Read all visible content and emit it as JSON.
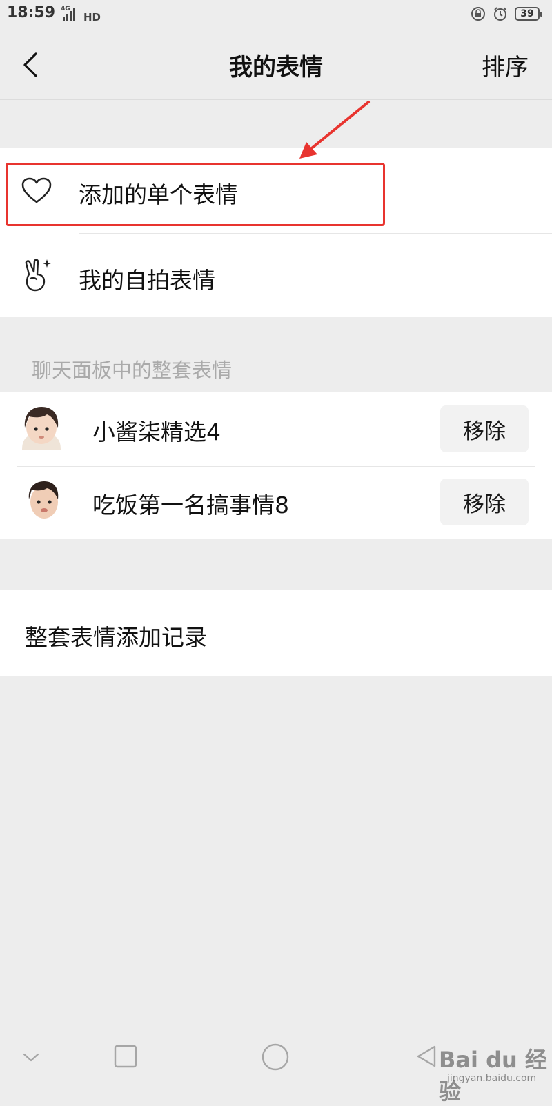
{
  "status_bar": {
    "time": "18:59",
    "network": "4G",
    "hd": "HD",
    "battery": "39"
  },
  "navbar": {
    "title": "我的表情",
    "sort_label": "排序"
  },
  "personal_items": [
    {
      "label": "添加的单个表情",
      "icon": "heart-icon"
    },
    {
      "label": "我的自拍表情",
      "icon": "victory-hand-icon"
    }
  ],
  "section": {
    "title": "聊天面板中的整套表情"
  },
  "sticker_sets": [
    {
      "name": "小酱柒精选4",
      "action": "移除"
    },
    {
      "name": "吃饭第一名搞事情8",
      "action": "移除"
    }
  ],
  "history": {
    "label": "整套表情添加记录"
  },
  "annotation": {
    "highlight_color": "#e8342f"
  },
  "watermark": {
    "text": "Bai du 经验",
    "url": "jingyan.baidu.com"
  }
}
